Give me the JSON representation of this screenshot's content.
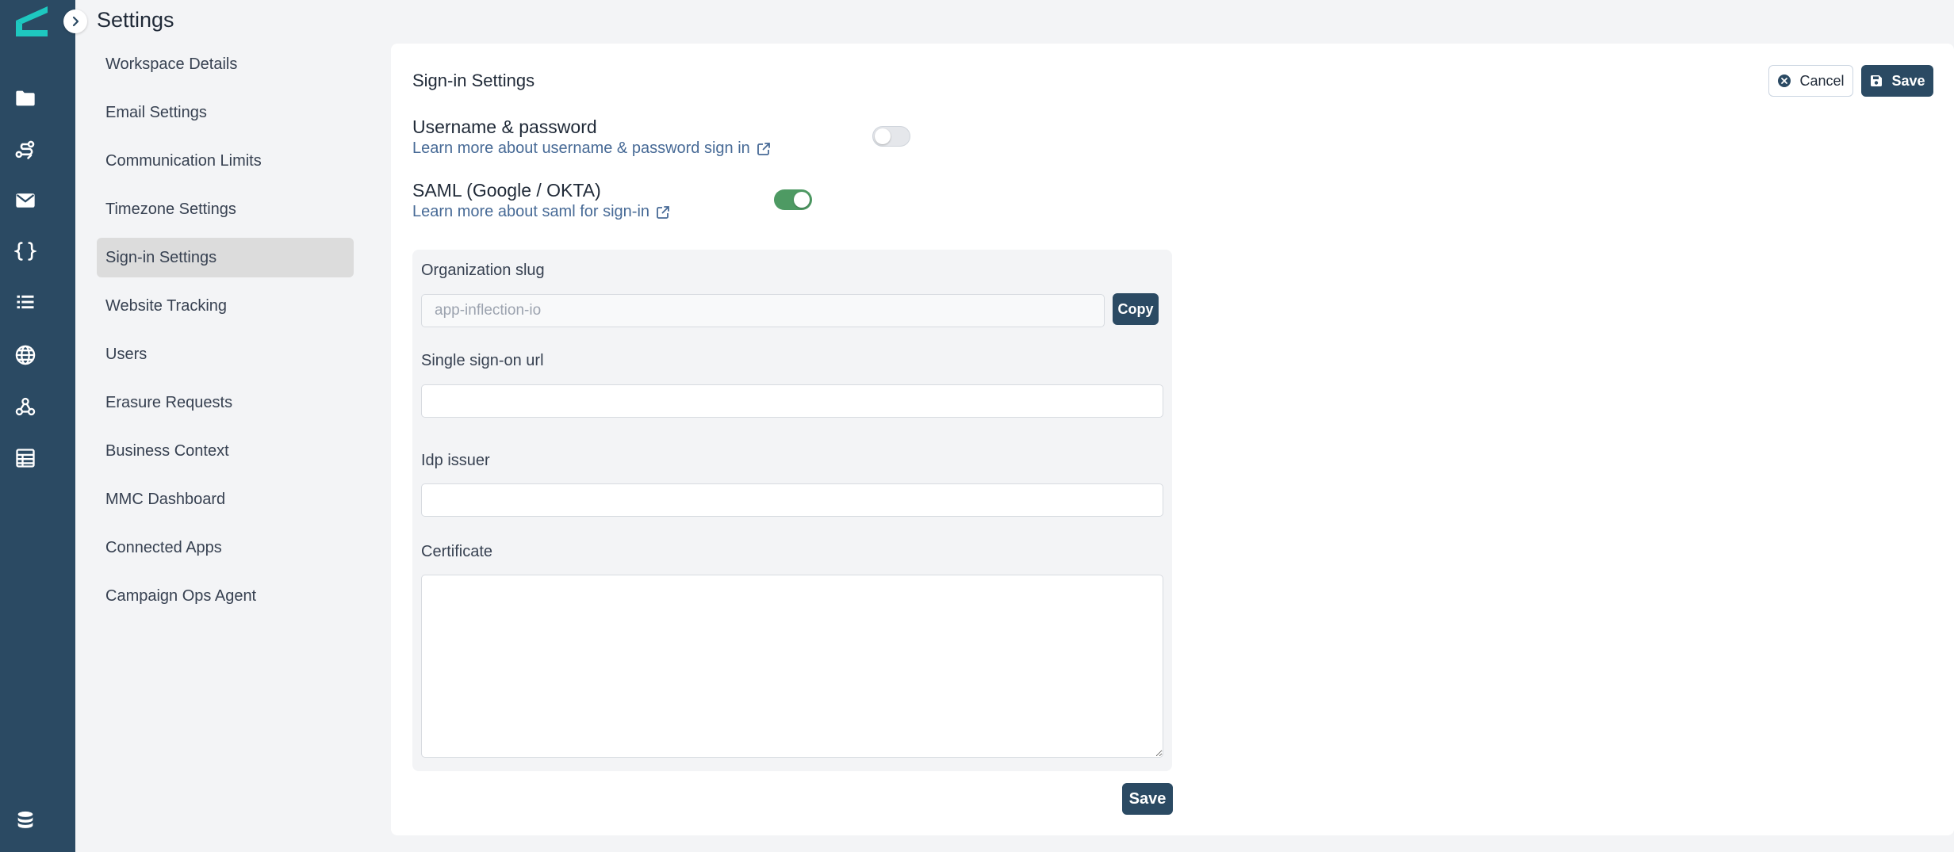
{
  "app": {
    "page_title": "Settings",
    "brand_color": "#2b4a63",
    "accent_color": "#1ec8c0"
  },
  "rail": {
    "icons": [
      "folder-icon",
      "journey-icon",
      "mail-icon",
      "code-braces-icon",
      "list-icon",
      "globe-icon",
      "webhook-icon",
      "table-icon",
      "database-icon"
    ]
  },
  "settings_nav": {
    "items": [
      {
        "label": "Workspace Details",
        "active": false
      },
      {
        "label": "Email Settings",
        "active": false
      },
      {
        "label": "Communication Limits",
        "active": false
      },
      {
        "label": "Timezone Settings",
        "active": false
      },
      {
        "label": "Sign-in Settings",
        "active": true
      },
      {
        "label": "Website Tracking",
        "active": false
      },
      {
        "label": "Users",
        "active": false
      },
      {
        "label": "Erasure Requests",
        "active": false
      },
      {
        "label": "Business Context",
        "active": false
      },
      {
        "label": "MMC Dashboard",
        "active": false
      },
      {
        "label": "Connected Apps",
        "active": false
      },
      {
        "label": "Campaign Ops Agent",
        "active": false
      }
    ]
  },
  "panel": {
    "title": "Sign-in Settings",
    "cancel_label": "Cancel",
    "save_label": "Save"
  },
  "options": {
    "username_password": {
      "label": "Username & password",
      "link": "Learn more about username & password sign in",
      "enabled": false
    },
    "saml": {
      "label": "SAML (Google / OKTA)",
      "link": "Learn more about saml for sign-in",
      "enabled": true
    }
  },
  "saml_form": {
    "org_slug_label": "Organization slug",
    "org_slug_value": "app-inflection-io",
    "copy_label": "Copy",
    "sso_url_label": "Single sign-on url",
    "sso_url_value": "",
    "idp_issuer_label": "Idp issuer",
    "idp_issuer_value": "",
    "certificate_label": "Certificate",
    "certificate_value": "",
    "save_label": "Save"
  }
}
